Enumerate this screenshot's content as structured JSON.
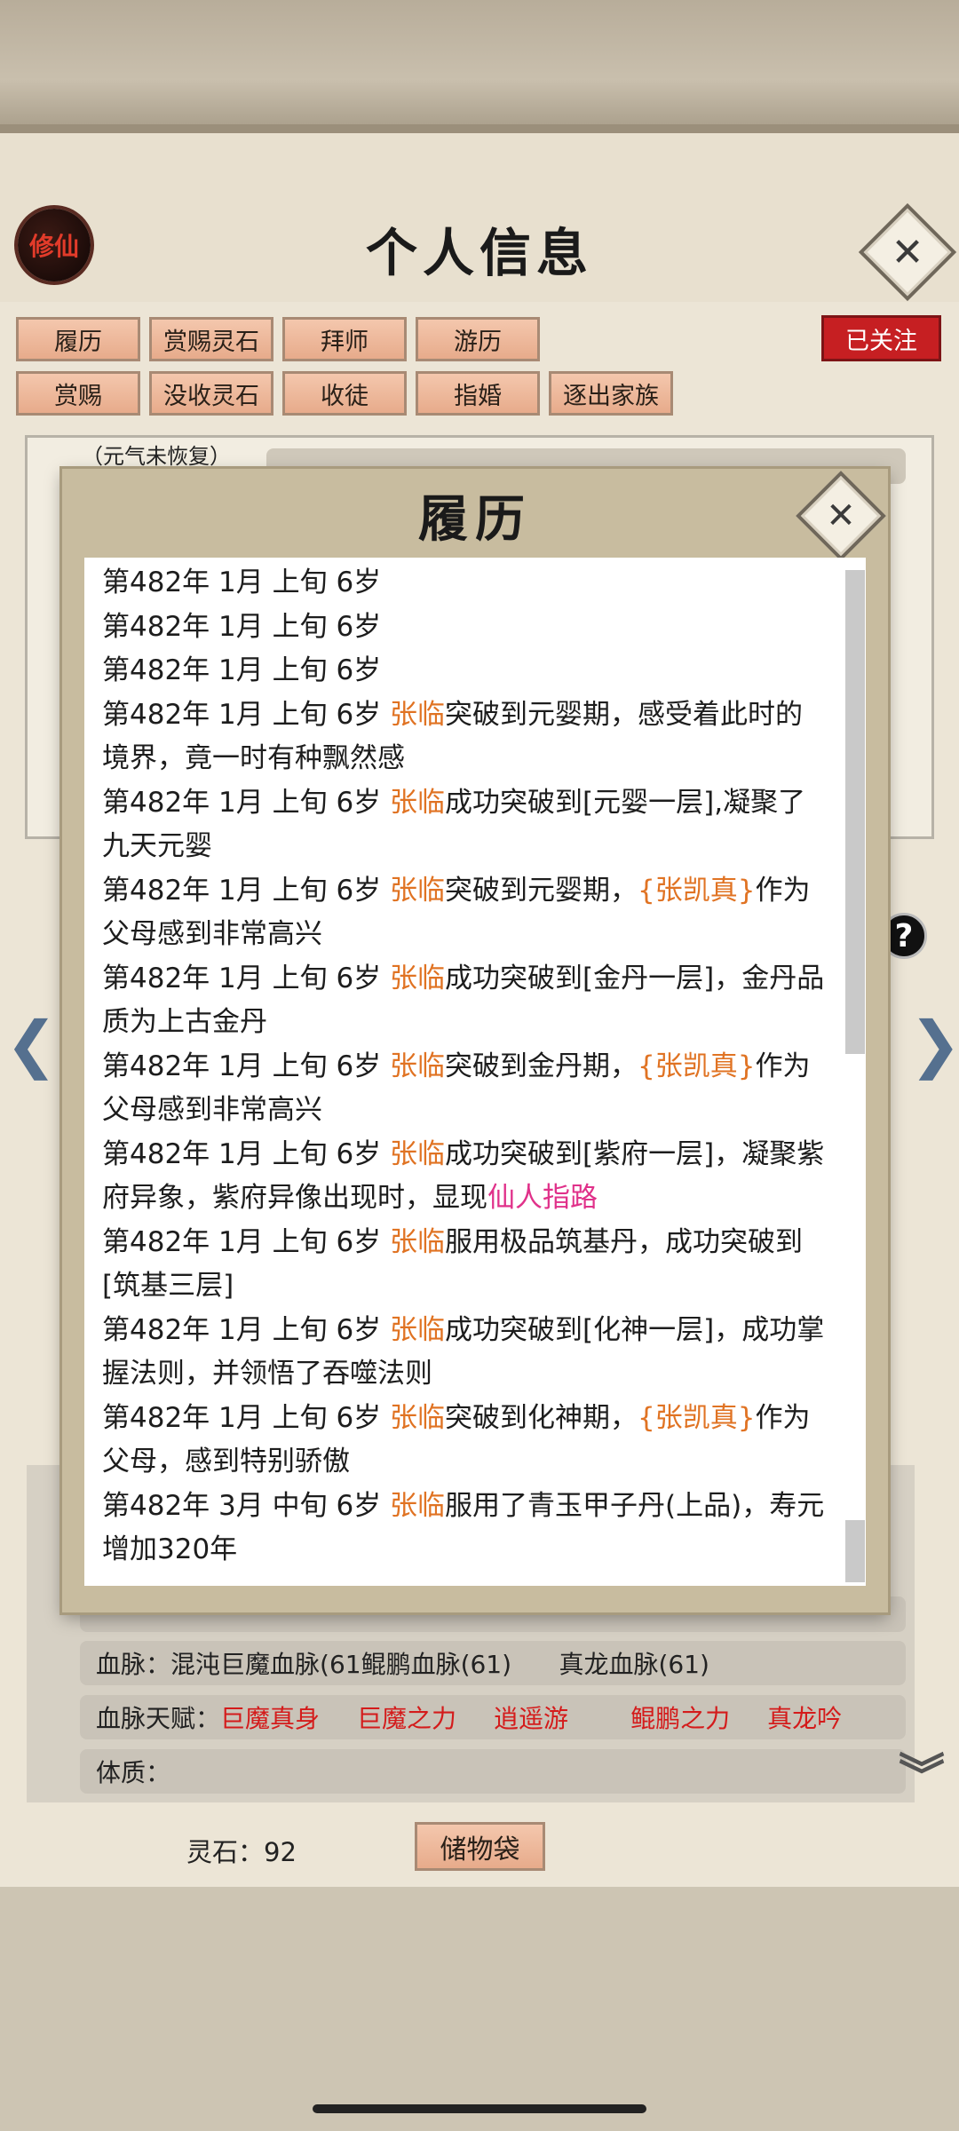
{
  "header": {
    "logo_text": "修仙",
    "title": "个人信息",
    "close_glyph": "✕"
  },
  "tabs_row1": [
    "履历",
    "赏赐灵石",
    "拜师",
    "游历"
  ],
  "tabs_row2": [
    "赏赐",
    "没收灵石",
    "收徒",
    "指婚",
    "逐出家族"
  ],
  "followed_label": "已关注",
  "status_note": "（元气未恢复）",
  "modal": {
    "title": "履历",
    "close_glyph": "✕",
    "entries": [
      [
        {
          "t": "第482年 1月 上旬  6岁"
        }
      ],
      [
        {
          "t": "第482年 1月 上旬  6岁"
        }
      ],
      [
        {
          "t": "第482年 1月 上旬  6岁"
        }
      ],
      [
        {
          "t": "第482年 1月 上旬  6岁 "
        },
        {
          "t": "张临",
          "c": "name"
        },
        {
          "t": "突破到元婴期，感受着此时的境界，竟一时有种飘然感"
        }
      ],
      [
        {
          "t": "第482年 1月 上旬 6岁 "
        },
        {
          "t": "张临",
          "c": "name"
        },
        {
          "t": "成功突破到[元婴一层],凝聚了九天元婴"
        }
      ],
      [
        {
          "t": "第482年 1月 上旬  6岁 "
        },
        {
          "t": "张临",
          "c": "name"
        },
        {
          "t": "突破到元婴期，"
        },
        {
          "t": "{张凯真}",
          "c": "name"
        },
        {
          "t": "作为父母感到非常高兴"
        }
      ],
      [
        {
          "t": "第482年 1月 上旬  6岁 "
        },
        {
          "t": "张临",
          "c": "name"
        },
        {
          "t": "成功突破到[金丹一层]，金丹品质为上古金丹"
        }
      ],
      [
        {
          "t": "第482年 1月 上旬  6岁 "
        },
        {
          "t": "张临",
          "c": "name"
        },
        {
          "t": "突破到金丹期，"
        },
        {
          "t": "{张凯真}",
          "c": "name"
        },
        {
          "t": "作为父母感到非常高兴"
        }
      ],
      [
        {
          "t": "第482年 1月 上旬  6岁 "
        },
        {
          "t": "张临",
          "c": "name"
        },
        {
          "t": "成功突破到[紫府一层]，凝聚紫府异象，紫府异像出现时，显现"
        },
        {
          "t": "仙人指路",
          "c": "pink"
        }
      ],
      [
        {
          "t": "第482年 1月 上旬  6岁 "
        },
        {
          "t": "张临",
          "c": "name"
        },
        {
          "t": "服用极品筑基丹，成功突破到[筑基三层]"
        }
      ],
      [
        {
          "t": "第482年 1月 上旬  6岁 "
        },
        {
          "t": "张临",
          "c": "name"
        },
        {
          "t": "成功突破到[化神一层]，成功掌握法则，并领悟了吞噬法则"
        }
      ],
      [
        {
          "t": "第482年 1月 上旬  6岁 "
        },
        {
          "t": "张临",
          "c": "name"
        },
        {
          "t": "突破到化神期，"
        },
        {
          "t": "{张凯真}",
          "c": "name"
        },
        {
          "t": "作为父母，感到特别骄傲"
        }
      ],
      [
        {
          "t": "第482年 3月 中旬 6岁 "
        },
        {
          "t": "张临",
          "c": "name"
        },
        {
          "t": "服用了青玉甲子丹(上品)，寿元增加320年"
        }
      ]
    ]
  },
  "bloodline": {
    "label": "血脉：",
    "value": "混沌巨魔血脉(61鲲鹏血脉(61)      真龙血脉(61)"
  },
  "bloodline_talent": {
    "label": "血脉天赋：",
    "items": [
      "巨魔真身",
      "巨魔之力",
      "逍遥游",
      "鲲鹏之力",
      "真龙吟"
    ]
  },
  "physique": {
    "label": "体质：",
    "value": ""
  },
  "spirit_stones": "灵石：92",
  "storage_bag_label": "储物袋",
  "colors": {
    "accent_orange": "#e07323",
    "highlight_pink": "#e0318a",
    "talent_red": "#d41b1b",
    "followed_red": "#c61f22"
  },
  "icons": {
    "left_arrow": "❮",
    "right_arrow": "❯",
    "help": "?",
    "expand": "︾"
  }
}
